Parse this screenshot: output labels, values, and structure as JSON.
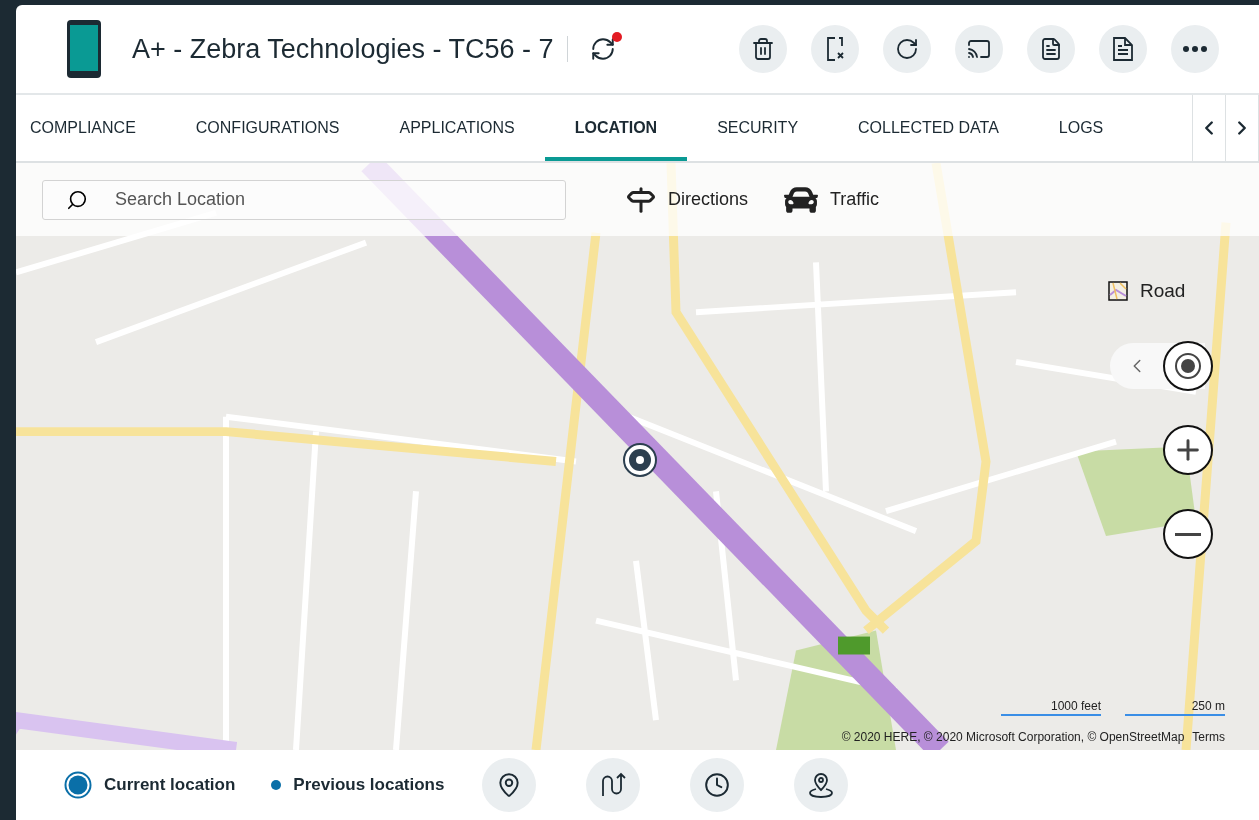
{
  "device": {
    "title": "A+ - Zebra Technologies - TC56 - 7",
    "sync_pending": true
  },
  "actions": [
    {
      "kind": "delete"
    },
    {
      "kind": "wipe"
    },
    {
      "kind": "reboot"
    },
    {
      "kind": "cast"
    },
    {
      "kind": "report"
    },
    {
      "kind": "document"
    },
    {
      "kind": "more"
    }
  ],
  "tabs": [
    {
      "label": "COMPLIANCE",
      "selected": false
    },
    {
      "label": "CONFIGURATIONS",
      "selected": false
    },
    {
      "label": "APPLICATIONS",
      "selected": false
    },
    {
      "label": "LOCATION",
      "selected": true
    },
    {
      "label": "SECURITY",
      "selected": false
    },
    {
      "label": "COLLECTED DATA",
      "selected": false
    },
    {
      "label": "LOGS",
      "selected": false
    }
  ],
  "map": {
    "search": {
      "placeholder": "Search Location"
    },
    "tools": [
      {
        "kind": "directions",
        "label": "Directions"
      },
      {
        "kind": "traffic",
        "label": "Traffic"
      }
    ],
    "map_type": "Road",
    "scale": [
      "1000 feet",
      "250 m"
    ],
    "copyright": "© 2020 HERE, © 2020 Microsoft Corporation, © OpenStreetMap",
    "terms": "Terms"
  },
  "legend": [
    {
      "kind": "current",
      "label": "Current location"
    },
    {
      "kind": "previous",
      "label": "Previous locations"
    }
  ],
  "bottom_actions": [
    {
      "kind": "pin"
    },
    {
      "kind": "route"
    },
    {
      "kind": "history"
    },
    {
      "kind": "area"
    }
  ]
}
